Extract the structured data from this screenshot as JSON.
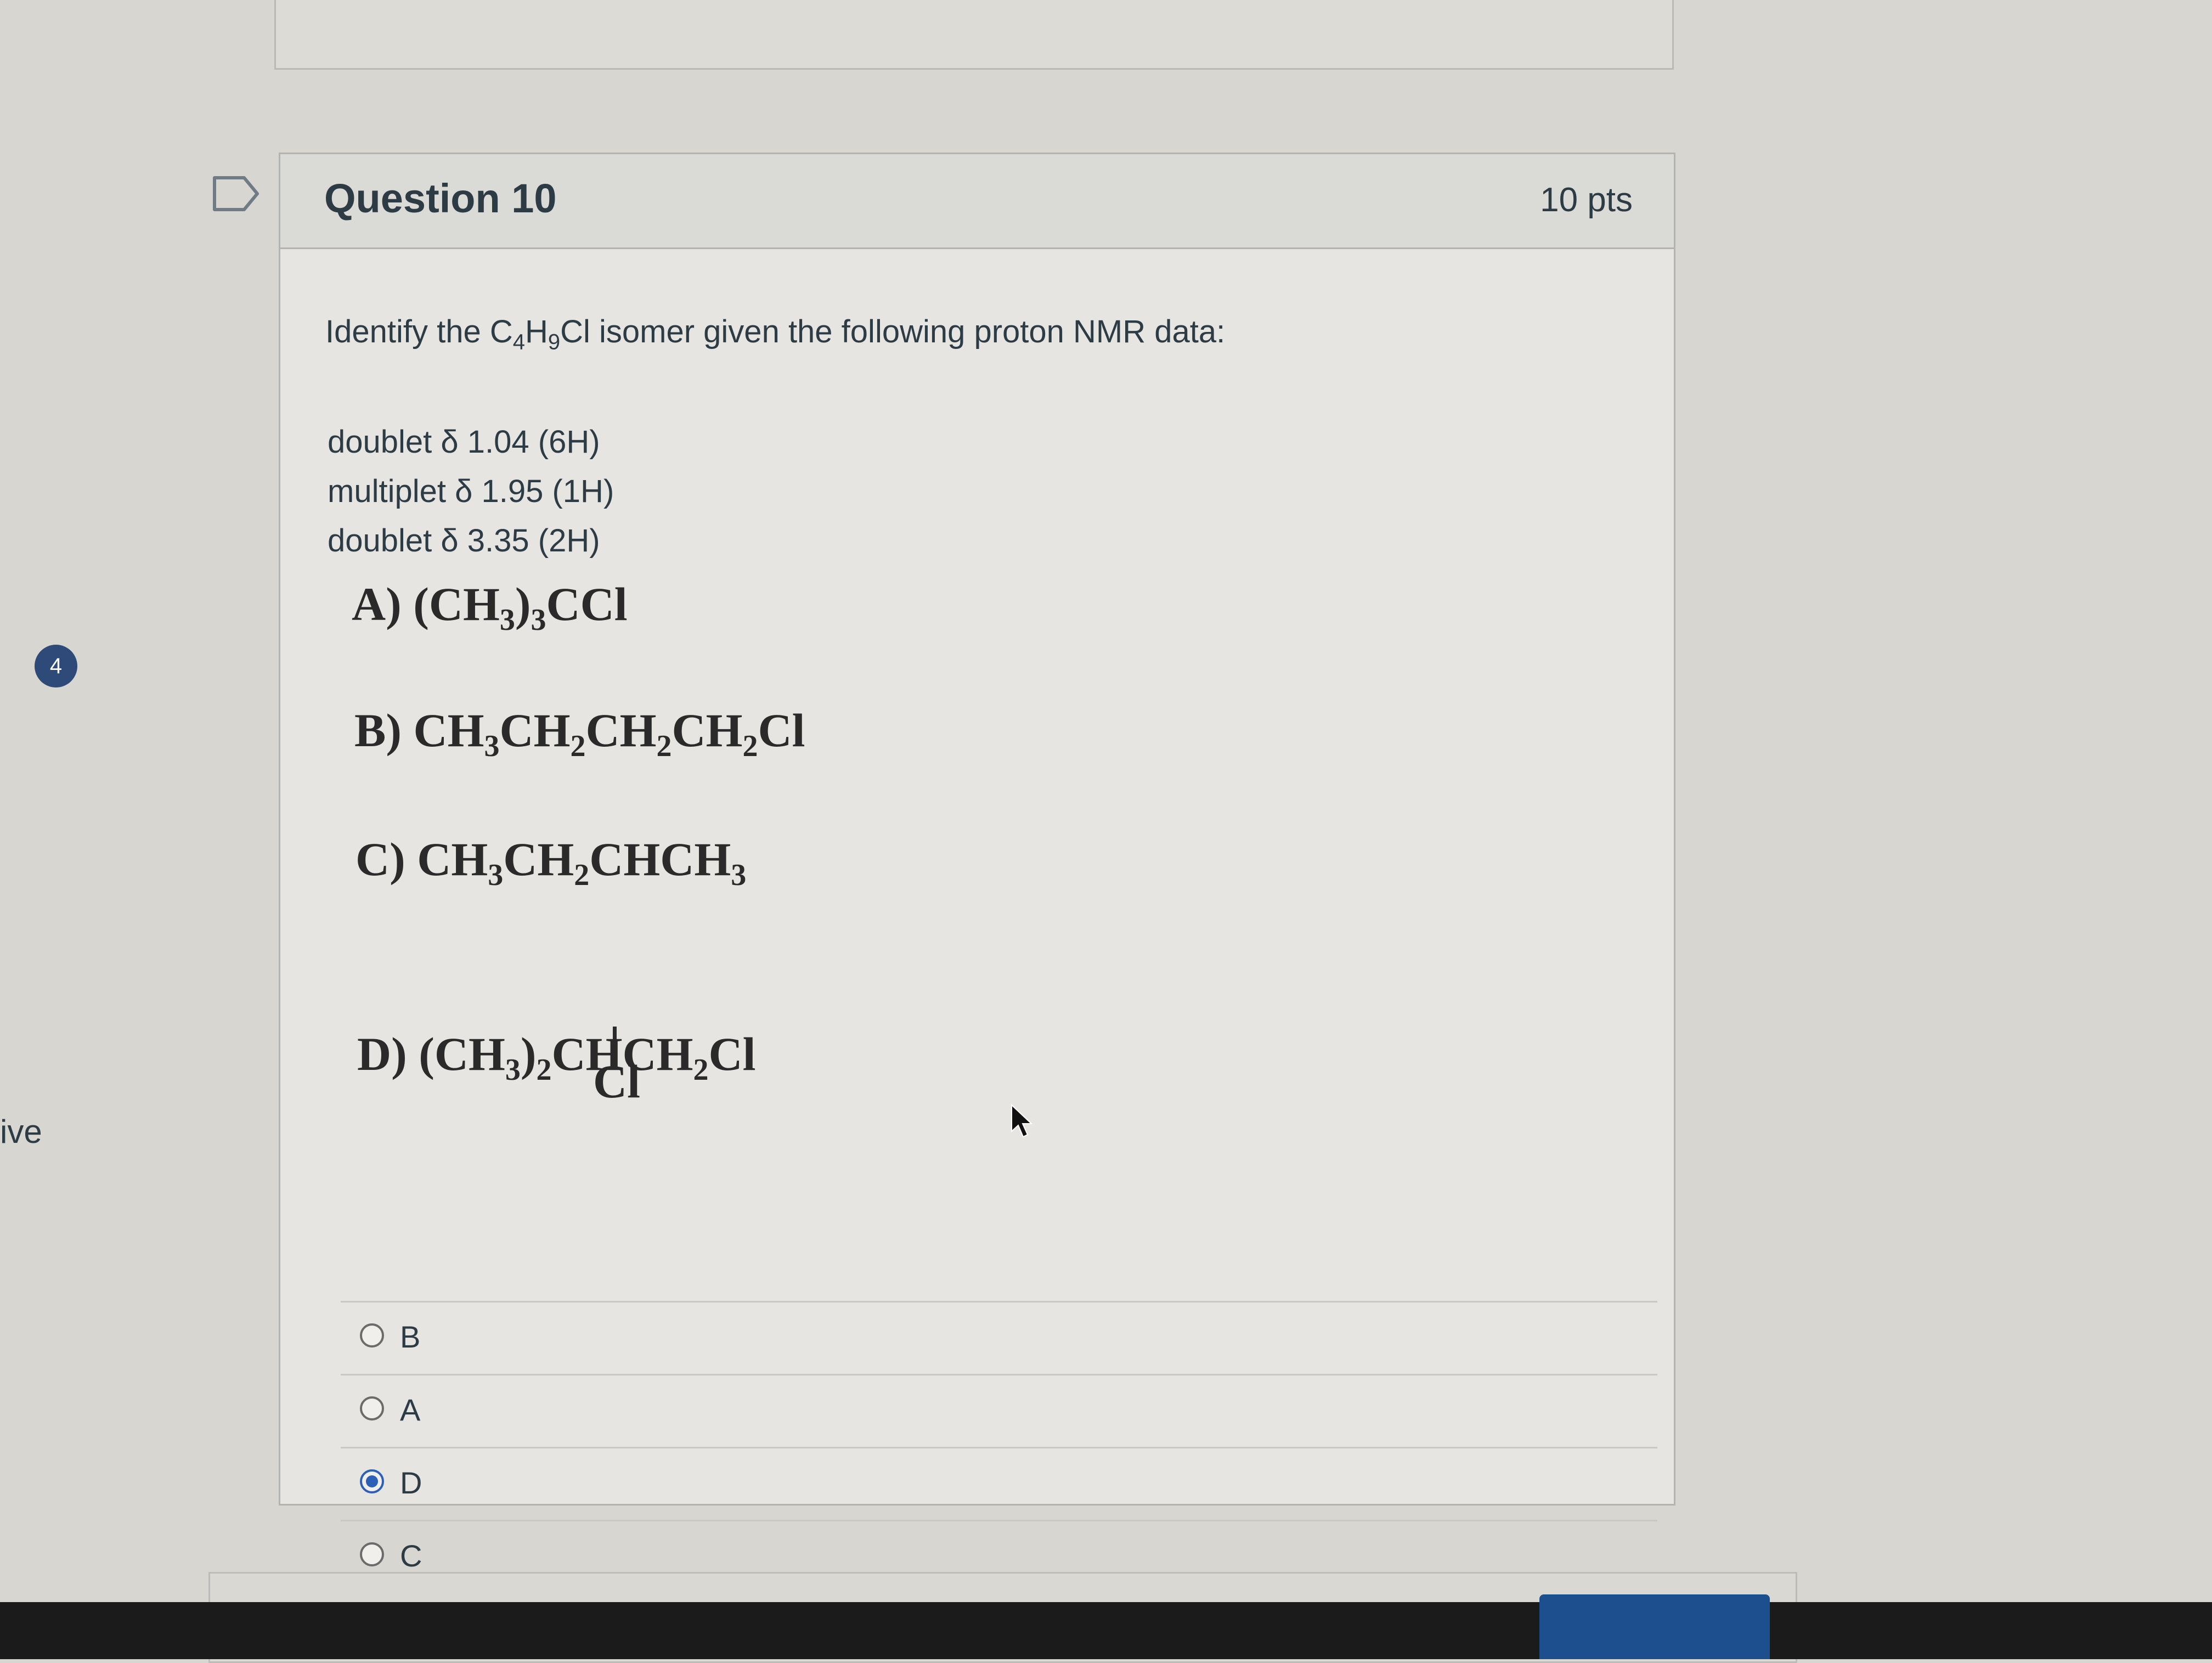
{
  "side": {
    "badge_count": "4",
    "partial_text": "ive"
  },
  "question": {
    "title": "Question 10",
    "points": "10 pts",
    "prompt": {
      "before": "Identify the C",
      "sub1": "4",
      "mid1": "H",
      "sub2": "9",
      "after": "Cl isomer given the following proton NMR data:"
    },
    "nmr_data": [
      "doublet δ 1.04 (6H)",
      "multiplet δ 1.95 (1H)",
      "doublet δ 3.35 (2H)"
    ],
    "choices_image": {
      "a": {
        "label": "A)",
        "t1": "(CH",
        "s1": "3",
        "t2": ")",
        "s2": "3",
        "t3": "CCl"
      },
      "b": {
        "label": "B)",
        "t1": "CH",
        "s1": "3",
        "t2": "CH",
        "s2": "2",
        "t3": "CH",
        "s3": "2",
        "t4": "CH",
        "s4": "2",
        "t5": "Cl"
      },
      "c": {
        "label": "C)",
        "t1": "CH",
        "s1": "3",
        "t2": "CH",
        "s2": "2",
        "t3": "CHCH",
        "s3": "3",
        "branch": "Cl"
      },
      "d": {
        "label": "D)",
        "t1": "(CH",
        "s1": "3",
        "t2": ")",
        "s2": "2",
        "t3": "CHCH",
        "s3": "2",
        "t4": "Cl"
      }
    },
    "answers": [
      {
        "label": "B",
        "checked": false
      },
      {
        "label": "A",
        "checked": false
      },
      {
        "label": "D",
        "checked": true
      },
      {
        "label": "C",
        "checked": false
      }
    ]
  },
  "colors": {
    "accent": "#2b5fb8",
    "badge": "#2d4a78",
    "text": "#2d3b45"
  }
}
